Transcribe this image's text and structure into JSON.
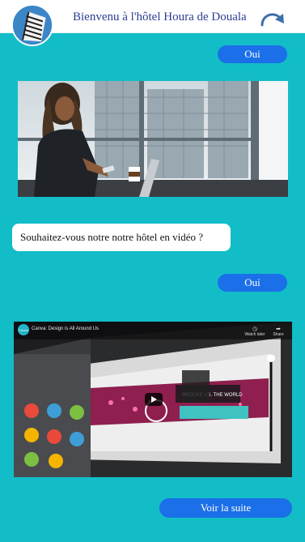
{
  "header": {
    "title": "Bienvenu à l'hôtel Houra de Douala",
    "logo_icon": "hotel-building-icon",
    "redo_icon": "redo-arrow-icon"
  },
  "messages": {
    "reply_1": "Oui",
    "question": "Souhaitez-vous notre notre hôtel en vidéo ?",
    "reply_2": "Oui"
  },
  "video": {
    "channel_badge": "Canva",
    "title": "Canva: Design is All Around Us",
    "watch_later": "Watch later",
    "share": "Share",
    "sign_text": "BROOKE VS. THE WORLD"
  },
  "footer": {
    "next_button": "Voir la suite"
  },
  "colors": {
    "background": "#12BDC8",
    "button": "#1B6FE8",
    "title": "#2C3D93"
  }
}
